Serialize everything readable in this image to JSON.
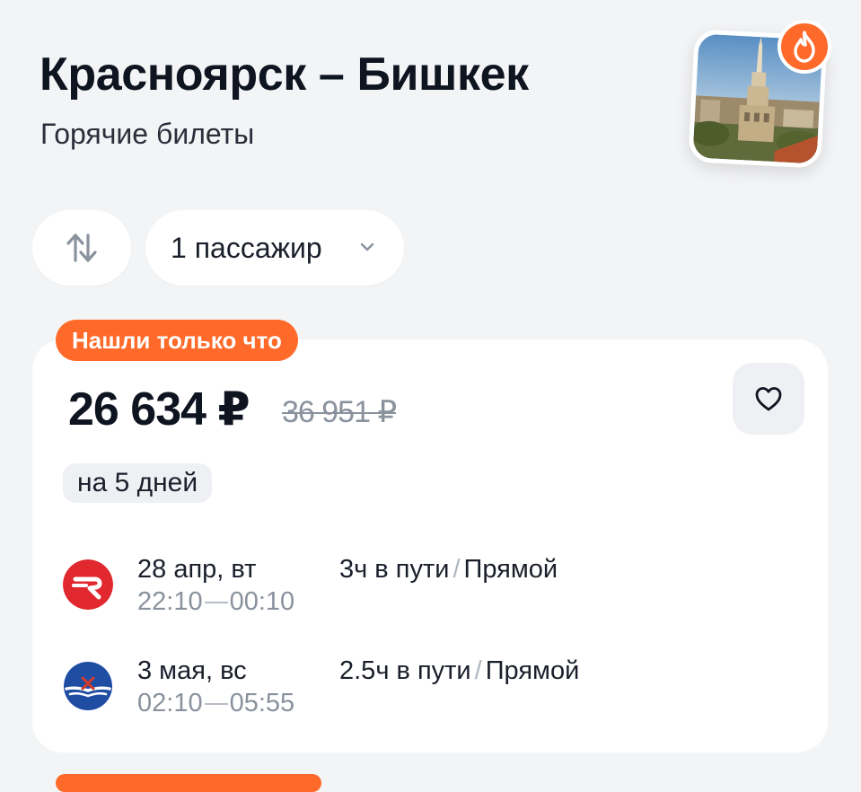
{
  "header": {
    "title": "Красноярск – Бишкек",
    "subtitle": "Горячие билеты",
    "photo_icon": "city-photo",
    "badge_icon": "flame-icon"
  },
  "controls": {
    "swap_icon": "swap-arrows-icon",
    "passengers_label": "1 пассажир",
    "passengers_icon": "chevron-down-icon"
  },
  "offer": {
    "badge": "Нашли только что",
    "price": "26 634 ₽",
    "old_price": "36 951 ₽",
    "favorite_icon": "heart-icon",
    "duration": "на 5 дней",
    "segments": [
      {
        "airline_icon": "red-wings-logo",
        "date": "28 апр, вт",
        "depart": "22:10",
        "arrive": "00:10",
        "travel_time": "3ч в пути",
        "separator": "/",
        "type": "Прямой"
      },
      {
        "airline_icon": "aeroflot-logo",
        "date": "3 мая, вс",
        "depart": "02:10",
        "arrive": "05:55",
        "travel_time": "2.5ч в пути",
        "separator": "/",
        "type": "Прямой"
      }
    ]
  },
  "colors": {
    "accent": "#ff6a2a",
    "background": "#f3f4f6",
    "card": "#ffffff",
    "muted_text": "#8a929e"
  }
}
